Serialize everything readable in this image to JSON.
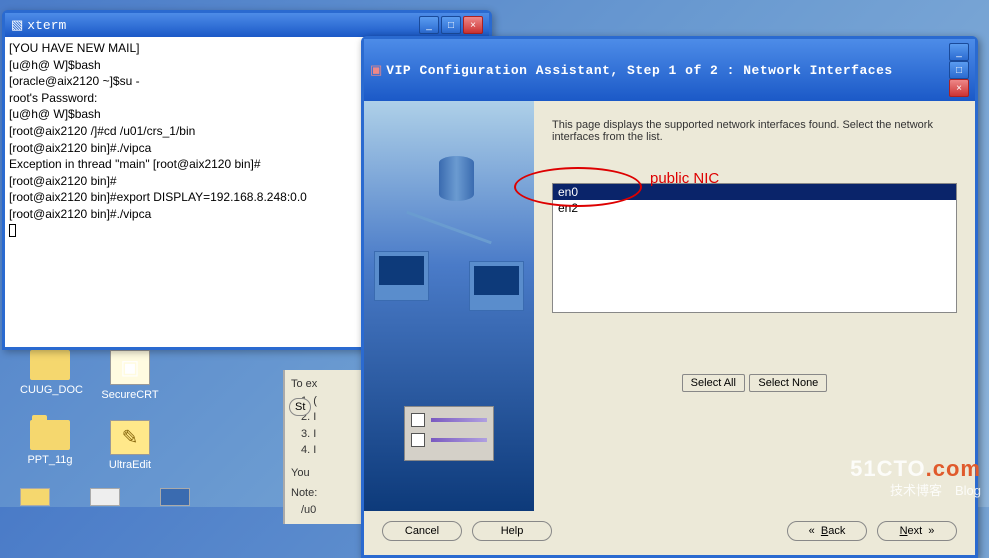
{
  "xterm": {
    "title": "xterm",
    "content": "[YOU HAVE NEW MAIL]\n[u@h@ W]$bash\n[oracle@aix2120 ~]$su -\nroot's Password:\n[u@h@ W]$bash\n[root@aix2120 /]#cd /u01/crs_1/bin\n[root@aix2120 bin]#./vipca\nException in thread \"main\" [root@aix2120 bin]#\n[root@aix2120 bin]#\n[root@aix2120 bin]#export DISPLAY=192.168.8.248:0.0\n[root@aix2120 bin]#./vipca"
  },
  "vip": {
    "title": "VIP Configuration Assistant, Step 1 of 2 : Network Interfaces",
    "desc": "This page displays the supported network interfaces found. Select the network interfaces from the list.",
    "items": [
      "en0",
      "en2"
    ],
    "select_all": "Select All",
    "select_none": "Select None",
    "cancel": "Cancel",
    "help": "Help",
    "back": "Back",
    "next": "Next"
  },
  "annotation": {
    "label": "public NIC"
  },
  "desktop": {
    "cuug": "CUUG_DOC",
    "secure": "SecureCRT",
    "ppt": "PPT_11g",
    "ultra": "UltraEdit"
  },
  "partial": {
    "l0": "To ex",
    "l1": "1. (",
    "l2": "2. I",
    "l3": "3. I",
    "l4": "4. I",
    "l5": "You",
    "l6": "Note:",
    "l7": "/u0",
    "st": "St"
  },
  "watermark": {
    "brand_white": "51CTO",
    "brand_red": ".com",
    "sub": "技术博客",
    "blog": "Blog"
  }
}
